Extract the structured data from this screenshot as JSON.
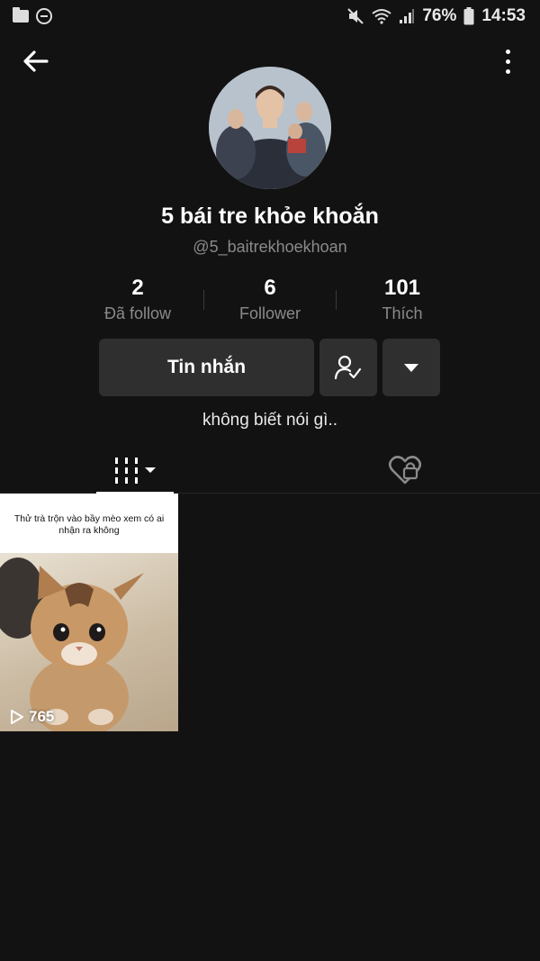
{
  "status_bar": {
    "battery": "76%",
    "time": "14:53"
  },
  "profile": {
    "display_name": "5 bái tre khỏe khoắn",
    "username": "@5_baitrekhoekhoan",
    "bio": "không biết nói gì.."
  },
  "stats": [
    {
      "value": "2",
      "label": "Đã follow"
    },
    {
      "value": "6",
      "label": "Follower"
    },
    {
      "value": "101",
      "label": "Thích"
    }
  ],
  "actions": {
    "message_label": "Tin nhắn"
  },
  "videos": [
    {
      "caption": "Thử trà trộn vào bầy mèo xem có ai nhận ra không",
      "views": "765"
    }
  ],
  "colors": {
    "background": "#121212",
    "button": "#2f2f2f",
    "secondary_text": "#8a8a8a"
  },
  "icons": [
    "back-arrow-icon",
    "more-vertical-icon",
    "person-check-icon",
    "chevron-down-icon",
    "grid-icon",
    "liked-heart-icon",
    "play-icon"
  ]
}
